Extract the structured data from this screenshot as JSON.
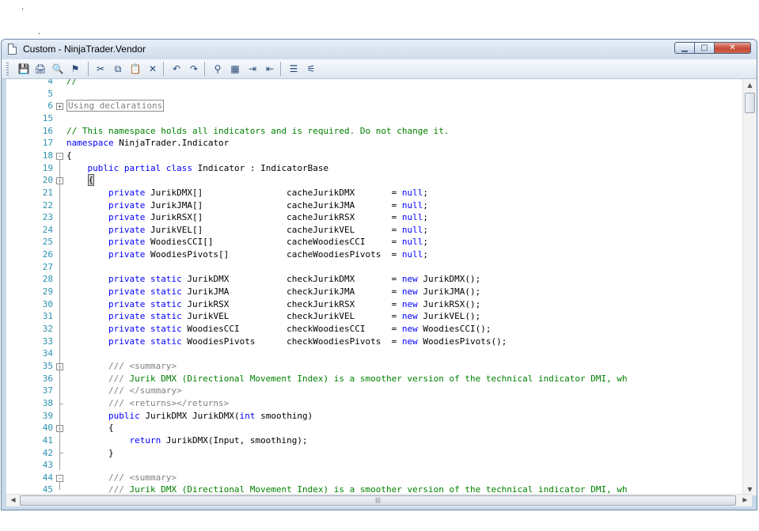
{
  "window": {
    "title": "Custom - NinjaTrader.Vendor",
    "minimize_glyph": "▁",
    "maximize_glyph": "▢",
    "close_glyph": "✕"
  },
  "toolbar": {
    "buttons": [
      {
        "name": "save-icon",
        "glyph": "💾"
      },
      {
        "name": "print-icon",
        "glyph": "🖨"
      },
      {
        "name": "print-preview-icon",
        "glyph": "🔍"
      },
      {
        "name": "properties-icon",
        "glyph": "⚑"
      },
      {
        "name": "cut-icon",
        "glyph": "✂"
      },
      {
        "name": "copy-icon",
        "glyph": "⧉"
      },
      {
        "name": "paste-icon",
        "glyph": "📋"
      },
      {
        "name": "delete-icon",
        "glyph": "✕"
      },
      {
        "name": "undo-icon",
        "glyph": "↶"
      },
      {
        "name": "redo-icon",
        "glyph": "↷"
      },
      {
        "name": "find-icon",
        "glyph": "⚲"
      },
      {
        "name": "replace-icon",
        "glyph": "▦"
      },
      {
        "name": "indent-icon",
        "glyph": "⇥"
      },
      {
        "name": "outdent-icon",
        "glyph": "⇤"
      },
      {
        "name": "comment-icon",
        "glyph": "☰"
      },
      {
        "name": "uncomment-icon",
        "glyph": "⚟"
      }
    ]
  },
  "editor": {
    "lines": [
      {
        "n": "4",
        "code": "//"
      },
      {
        "n": "5",
        "code": ""
      },
      {
        "n": "6",
        "code": "Using declarations"
      },
      {
        "n": "15",
        "code": ""
      },
      {
        "n": "16",
        "code": "// This namespace holds all indicators and is required. Do not change it."
      },
      {
        "n": "17",
        "code": "namespace NinjaTrader.Indicator"
      },
      {
        "n": "18",
        "code": "{"
      },
      {
        "n": "19",
        "code": "    public partial class Indicator : IndicatorBase"
      },
      {
        "n": "20",
        "code": "    {"
      },
      {
        "n": "21",
        "code": "        private JurikDMX[]                cacheJurikDMX       = null;"
      },
      {
        "n": "22",
        "code": "        private JurikJMA[]                cacheJurikJMA       = null;"
      },
      {
        "n": "23",
        "code": "        private JurikRSX[]                cacheJurikRSX       = null;"
      },
      {
        "n": "24",
        "code": "        private JurikVEL[]                cacheJurikVEL       = null;"
      },
      {
        "n": "25",
        "code": "        private WoodiesCCI[]              cacheWoodiesCCI     = null;"
      },
      {
        "n": "26",
        "code": "        private WoodiesPivots[]           cacheWoodiesPivots  = null;"
      },
      {
        "n": "27",
        "code": ""
      },
      {
        "n": "28",
        "code": "        private static JurikDMX           checkJurikDMX       = new JurikDMX();"
      },
      {
        "n": "29",
        "code": "        private static JurikJMA           checkJurikJMA       = new JurikJMA();"
      },
      {
        "n": "30",
        "code": "        private static JurikRSX           checkJurikRSX       = new JurikRSX();"
      },
      {
        "n": "31",
        "code": "        private static JurikVEL           checkJurikVEL       = new JurikVEL();"
      },
      {
        "n": "32",
        "code": "        private static WoodiesCCI         checkWoodiesCCI     = new WoodiesCCI();"
      },
      {
        "n": "33",
        "code": "        private static WoodiesPivots      checkWoodiesPivots  = new WoodiesPivots();"
      },
      {
        "n": "34",
        "code": ""
      },
      {
        "n": "35",
        "code": "        /// <summary>"
      },
      {
        "n": "36",
        "code": "        /// Jurik DMX (Directional Movement Index) is a smoother version of the technical indicator DMI, wh"
      },
      {
        "n": "37",
        "code": "        /// </summary>"
      },
      {
        "n": "38",
        "code": "        /// <returns></returns>"
      },
      {
        "n": "39",
        "code": "        public JurikDMX JurikDMX(int smoothing)"
      },
      {
        "n": "40",
        "code": "        {"
      },
      {
        "n": "41",
        "code": "            return JurikDMX(Input, smoothing);"
      },
      {
        "n": "42",
        "code": "        }"
      },
      {
        "n": "43",
        "code": ""
      },
      {
        "n": "44",
        "code": "        /// <summary>"
      },
      {
        "n": "45",
        "code": "        /// Jurik DMX (Directional Movement Index) is a smoother version of the technical indicator DMI, wh"
      }
    ]
  },
  "scrollbars": {
    "up_arrow": "▲",
    "down_arrow": "▼",
    "left_arrow": "◀",
    "right_arrow": "▶",
    "thumb_grip": "|||"
  }
}
